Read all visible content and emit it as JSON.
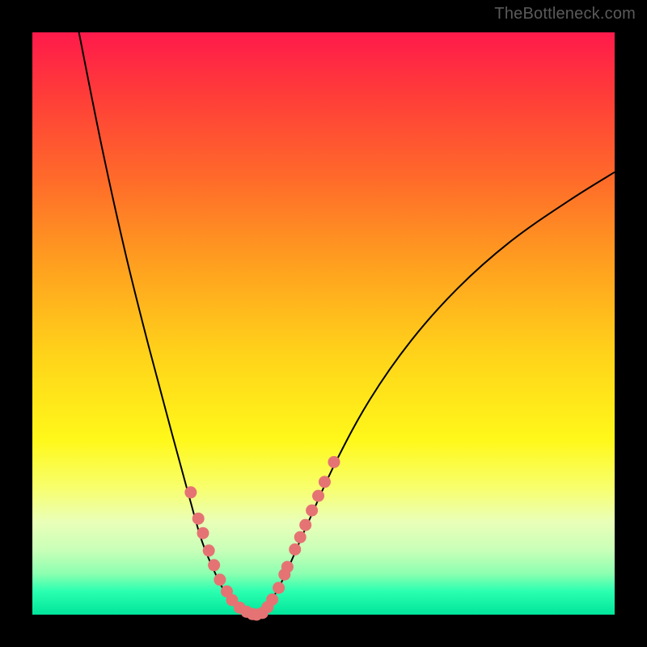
{
  "watermark": "TheBottleneck.com",
  "chart_data": {
    "type": "line",
    "title": "",
    "xlabel": "",
    "ylabel": "",
    "ylim": [
      0,
      100
    ],
    "xlim": [
      0,
      100
    ],
    "series": [
      {
        "name": "curve-left",
        "x": [
          8,
          12,
          16,
          20,
          24,
          27,
          29,
          31,
          33,
          35,
          36,
          37,
          38
        ],
        "values": [
          100,
          80,
          62,
          46,
          31,
          20,
          13,
          8,
          4,
          1.5,
          0.5,
          0,
          0
        ]
      },
      {
        "name": "curve-right",
        "x": [
          38,
          40,
          43,
          47,
          52,
          58,
          65,
          73,
          82,
          92,
          100
        ],
        "values": [
          0,
          1,
          6,
          15,
          26,
          37,
          47,
          56,
          64,
          71,
          76
        ]
      }
    ],
    "markers": [
      {
        "name": "dots-left",
        "x": [
          27.2,
          28.5,
          29.3,
          30.3,
          31.2,
          32.2,
          33.4,
          34.3,
          35.6,
          36.8,
          37.8,
          38.5
        ],
        "values": [
          21.0,
          16.5,
          14.0,
          11.0,
          8.5,
          6.0,
          4.0,
          2.5,
          1.2,
          0.5,
          0.1,
          0.0
        ]
      },
      {
        "name": "dots-right",
        "x": [
          39.5,
          40.4,
          41.2,
          42.3,
          43.3,
          43.8,
          45.1,
          46.0,
          46.9,
          48.0,
          49.1,
          50.2,
          51.8
        ],
        "values": [
          0.3,
          1.3,
          2.6,
          4.6,
          6.9,
          8.2,
          11.2,
          13.3,
          15.4,
          17.9,
          20.4,
          22.8,
          26.2
        ]
      }
    ],
    "colors": {
      "curve": "#000000",
      "marker": "#e57373"
    }
  }
}
